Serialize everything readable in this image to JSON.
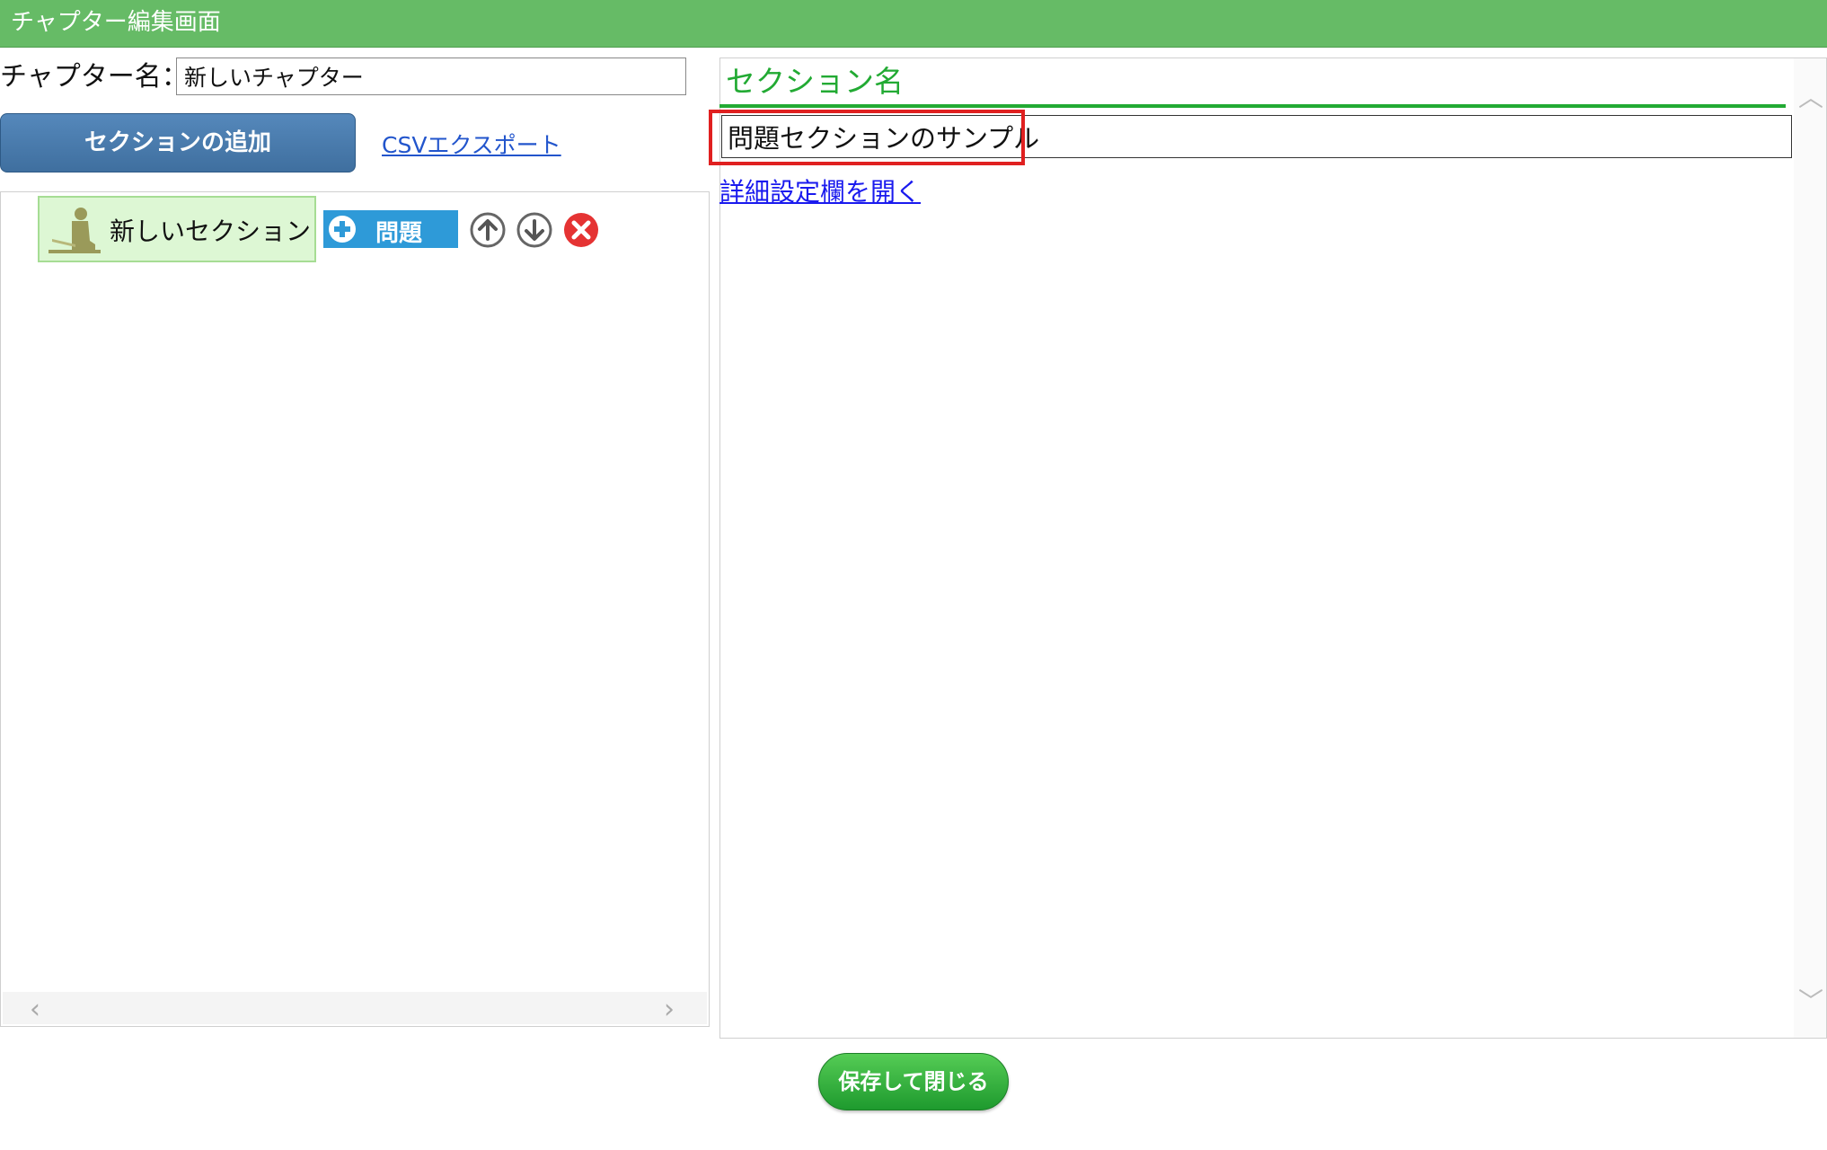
{
  "window": {
    "title": "チャプター編集画面"
  },
  "chapter": {
    "label": "チャプター名：",
    "name_value": "新しいチャプター"
  },
  "toolbar": {
    "add_section_label": "セクションの追加",
    "csv_export_label": "CSVエクスポート"
  },
  "tree": {
    "section_node": {
      "label": "新しいセクション",
      "icon": "person-desk-icon"
    },
    "question_button_label": "問題",
    "actions": [
      "move-up-icon",
      "move-down-icon",
      "delete-icon"
    ]
  },
  "detail": {
    "section_name_heading": "セクション名",
    "section_name_value": "問題セクションのサンプル",
    "open_details_link": "詳細設定欄を開く"
  },
  "footer": {
    "save_close_label": "保存して閉じる"
  },
  "colors": {
    "titlebar": "#66bb66",
    "accent_green": "#22aa33",
    "primary_blue": "#3f6f9f",
    "question_blue": "#2e9ad8",
    "delete_red": "#e53333",
    "highlight_red": "#e02020"
  }
}
